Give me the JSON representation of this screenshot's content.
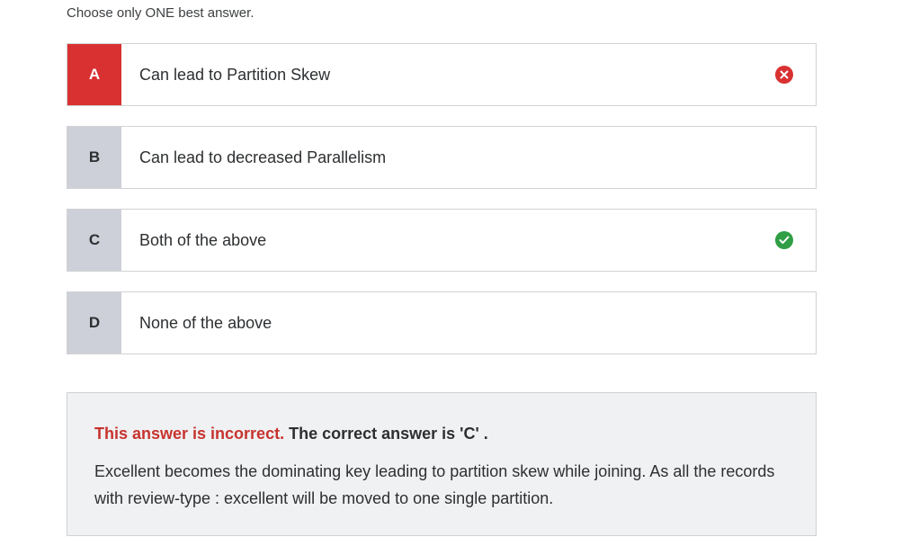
{
  "instruction": "Choose only ONE best answer.",
  "options": [
    {
      "letter": "A",
      "text": "Can lead to Partition Skew",
      "status": "wrong"
    },
    {
      "letter": "B",
      "text": "Can lead to decreased Parallelism",
      "status": "none"
    },
    {
      "letter": "C",
      "text": "Both of the above",
      "status": "correct"
    },
    {
      "letter": "D",
      "text": "None of the above",
      "status": "none"
    }
  ],
  "feedback": {
    "incorrect_label": "This answer is incorrect.",
    "correct_answer_text": "The correct answer is 'C' .",
    "explanation": "Excellent becomes the dominating key leading to partition skew while joining. As all the records with review-type : excellent will be moved to one single partition."
  },
  "colors": {
    "wrong": "#d93132",
    "correct": "#2f9e44",
    "letter_bg": "#cdd0d8",
    "feedback_bg": "#f0f1f3"
  },
  "icons": {
    "wrong": "x-circle-icon",
    "correct": "check-circle-icon"
  }
}
